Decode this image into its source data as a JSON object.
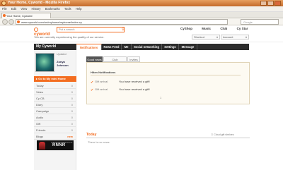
{
  "browser": {
    "window_title": "Your Home, Cyworld - Mozilla Firefox",
    "menu": [
      "File",
      "Edit",
      "View",
      "History",
      "Bookmarks",
      "Tools",
      "Help"
    ],
    "tab_title": "Your Home, Cyworld",
    "address": "www.cyworld.com/us/myhome/myhome/index.cy",
    "search_placeholder": "Google"
  },
  "header": {
    "logo": "cyworld",
    "search_placeholder": "Put a search",
    "nav": [
      "CyShop",
      "Music",
      "Club",
      "Cy Star"
    ],
    "intro": "You are currently experiencing the quality of our service.",
    "lang_select": "Shortcut",
    "user_select": "Account"
  },
  "sidebar": {
    "title": "My Cyworld",
    "status": "Updated",
    "name": "Zonya Johnson",
    "home_button": "Go to My mini Home",
    "items": [
      {
        "label": "Today",
        "count": "0"
      },
      {
        "label": "Video",
        "count": "0"
      },
      {
        "label": "Cy CB",
        "count": "0"
      },
      {
        "label": "Diary",
        "count": "0"
      },
      {
        "label": "Campaign",
        "count": "0"
      },
      {
        "label": "Audio",
        "count": "0"
      },
      {
        "label": "Gift",
        "count": "0"
      },
      {
        "label": "Friends",
        "count": "0"
      },
      {
        "label": "Blogs",
        "count": "new"
      }
    ],
    "banner_small": "Cyworld Entertainment",
    "banner_big": "RNNR"
  },
  "main_tabs": [
    "Notifications",
    "News Feed",
    "Me",
    "Social networking",
    "Settings",
    "Message"
  ],
  "notifications": {
    "sub_tabs": [
      "Good news",
      "Club Notifications",
      "Invites"
    ],
    "title": "Hiten Notifications",
    "rows": [
      {
        "who": "Gift arrival",
        "msg": "You have received a gift!"
      },
      {
        "who": "Gift arrival",
        "msg": "You have received a gift!"
      }
    ],
    "more": "1"
  },
  "today": {
    "title": "Today",
    "empty": "There is no news.",
    "link": "Cloud gift shelves"
  }
}
